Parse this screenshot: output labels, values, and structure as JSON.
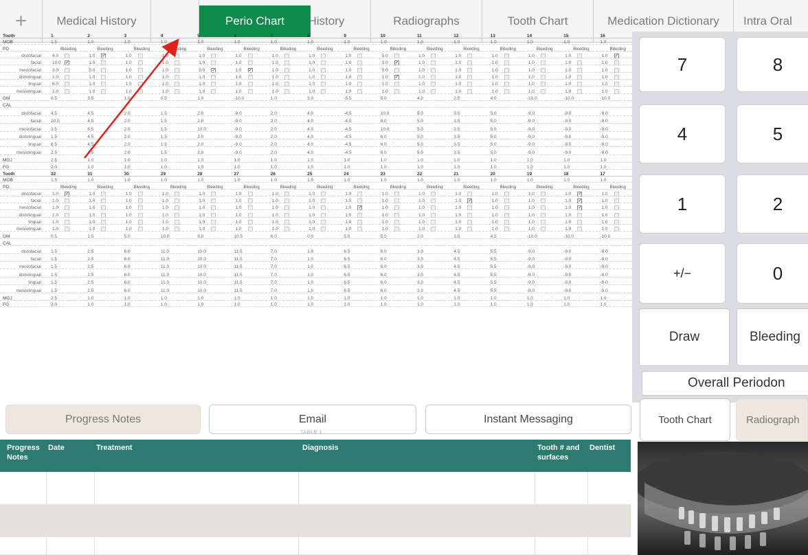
{
  "tabs": {
    "plus": "+",
    "medical_history": "Medical History",
    "perio_chart": "Perio Chart",
    "dental_history": "l History",
    "radiographs": "Radiographs",
    "tooth_chart": "Tooth Chart",
    "medication_dictionary": "Medication Dictionary",
    "intra_oral": "Intra Oral"
  },
  "perio": {
    "upper_teeth": [
      "1",
      "2",
      "3",
      "4",
      "5",
      "6",
      "7",
      "8",
      "9",
      "10",
      "11",
      "12",
      "13",
      "14",
      "15",
      "16"
    ],
    "lower_teeth": [
      "32",
      "31",
      "30",
      "29",
      "28",
      "27",
      "26",
      "25",
      "24",
      "23",
      "22",
      "21",
      "20",
      "19",
      "18",
      "17"
    ],
    "labels": {
      "tooth": "Tooth",
      "mob": "MOB",
      "pd": "PD",
      "gm": "GM",
      "cal": "CAL",
      "mgj": "MGJ",
      "fg": "FG",
      "bleeding": "Bleeding",
      "surfaces": [
        "distofacial",
        "facial",
        "mesiofacial",
        "distolingual",
        "lingual",
        "mesiolingual"
      ]
    },
    "upper_mob": [
      "1.5",
      "1.0",
      "1.0",
      "1.0",
      "1.0",
      "1.0",
      "1.0",
      "1.0",
      "1.0",
      "1.0",
      "1.0",
      "1.0",
      "1.0",
      "1.0",
      "1.0",
      "1.0"
    ],
    "upper_pd": [
      [
        "4.0",
        "1.0",
        "1.0",
        "1.0",
        "1.0",
        "1.0",
        "1.0",
        "1.0",
        "1.0",
        "5.0",
        "1.0",
        "1.0",
        "1.0",
        "1.0",
        "1.0",
        "1.0"
      ],
      [
        "10.0",
        "1.0",
        "1.0",
        "1.0",
        "1.0",
        "1.0",
        "1.0",
        "1.0",
        "1.0",
        "3.0",
        "1.0",
        "1.0",
        "1.0",
        "1.0",
        "1.0",
        "1.0"
      ],
      [
        "3.0",
        "5.0",
        "1.0",
        "1.0",
        "9.0",
        "1.0",
        "1.0",
        "1.0",
        "1.0",
        "5.0",
        "1.0",
        "1.0",
        "1.0",
        "1.0",
        "1.0",
        "1.0"
      ],
      [
        "1.0",
        "1.0",
        "1.0",
        "1.0",
        "1.0",
        "1.0",
        "1.0",
        "1.0",
        "1.0",
        "1.0",
        "1.0",
        "1.0",
        "1.0",
        "1.0",
        "1.0",
        "1.0"
      ],
      [
        "6.0",
        "1.0",
        "1.0",
        "1.0",
        "1.0",
        "1.0",
        "1.0",
        "1.0",
        "1.0",
        "1.0",
        "1.0",
        "1.0",
        "1.0",
        "1.0",
        "1.0",
        "1.0"
      ],
      [
        "2.0",
        "1.0",
        "1.0",
        "1.0",
        "1.0",
        "1.0",
        "1.0",
        "1.0",
        "1.0",
        "1.0",
        "1.0",
        "1.0",
        "1.0",
        "1.0",
        "1.0",
        "1.0"
      ]
    ],
    "upper_bleeding_on": [
      [
        0,
        1
      ],
      [
        0,
        15
      ],
      [
        1,
        0
      ],
      [
        2,
        4
      ],
      [
        2,
        5
      ],
      [
        1,
        9
      ],
      [
        3,
        9
      ]
    ],
    "upper_gm": [
      "0.5",
      "3.5",
      "1.0",
      "0.5",
      "1.0",
      "-10.0",
      "1.0",
      "3.0",
      "-5.5",
      "5.0",
      "4.0",
      "2.5",
      "4.0",
      "-10.0",
      "-10.0",
      "-10.0"
    ],
    "upper_cal": [
      [
        "4.5",
        "4.5",
        "2.0",
        "1.5",
        "2.0",
        "-9.0",
        "2.0",
        "4.0",
        "-4.5",
        "10.0",
        "5.0",
        "3.5",
        "5.0",
        "-9.0",
        "-9.0",
        "-9.0"
      ],
      [
        "10.5",
        "4.5",
        "2.0",
        "1.5",
        "2.0",
        "-9.0",
        "2.0",
        "4.0",
        "-4.5",
        "8.0",
        "5.0",
        "3.5",
        "5.0",
        "-9.0",
        "-9.0",
        "-9.0"
      ],
      [
        "3.5",
        "8.5",
        "2.0",
        "1.5",
        "10.0",
        "-9.0",
        "2.0",
        "4.0",
        "-4.5",
        "10.0",
        "5.0",
        "3.5",
        "5.0",
        "-9.0",
        "-9.0",
        "-9.0"
      ],
      [
        "1.5",
        "4.5",
        "2.0",
        "1.5",
        "2.0",
        "-9.0",
        "2.0",
        "4.0",
        "-4.5",
        "6.0",
        "5.0",
        "3.5",
        "5.0",
        "-9.0",
        "-9.0",
        "-9.0"
      ],
      [
        "6.5",
        "4.5",
        "2.0",
        "1.5",
        "2.0",
        "-9.0",
        "2.0",
        "4.0",
        "-4.5",
        "6.0",
        "5.0",
        "3.5",
        "5.0",
        "-9.0",
        "-9.0",
        "-9.0"
      ],
      [
        "2.5",
        "4.5",
        "2.0",
        "1.5",
        "2.0",
        "-9.0",
        "2.0",
        "4.0",
        "-4.5",
        "6.0",
        "5.0",
        "3.5",
        "5.0",
        "-9.0",
        "-9.0",
        "-9.0"
      ]
    ],
    "upper_mgj": [
      "2.5",
      "1.0",
      "1.0",
      "1.0",
      "1.0",
      "1.0",
      "1.0",
      "1.0",
      "1.0",
      "1.0",
      "1.0",
      "1.0",
      "1.0",
      "1.0",
      "1.0",
      "1.0"
    ],
    "upper_fg": [
      "2.0",
      "1.0",
      "1.0",
      "1.0",
      "1.0",
      "1.0",
      "1.0",
      "1.0",
      "1.0",
      "1.0",
      "1.0",
      "1.0",
      "1.0",
      "1.0",
      "1.0",
      "1.0"
    ],
    "lower_mob": [
      "1.5",
      "1.0",
      "1.0",
      "1.0",
      "1.0",
      "1.0",
      "1.0",
      "1.0",
      "1.0",
      "1.0",
      "1.0",
      "1.0",
      "1.0",
      "1.0",
      "1.0",
      "1.0"
    ],
    "lower_pd": [
      [
        "1.0",
        "1.0",
        "1.0",
        "1.0",
        "1.0",
        "1.0",
        "1.0",
        "1.0",
        "1.0",
        "1.0",
        "1.0",
        "1.0",
        "1.0",
        "1.0",
        "1.0",
        "1.0"
      ],
      [
        "1.0",
        "1.0",
        "1.0",
        "1.0",
        "1.0",
        "1.0",
        "1.0",
        "1.0",
        "1.0",
        "1.0",
        "1.0",
        "1.0",
        "1.0",
        "1.0",
        "1.0",
        "1.0"
      ],
      [
        "1.0",
        "1.0",
        "1.0",
        "1.0",
        "1.0",
        "1.0",
        "1.0",
        "1.0",
        "1.0",
        "1.0",
        "1.0",
        "1.0",
        "1.0",
        "1.0",
        "1.0",
        "1.0"
      ],
      [
        "1.0",
        "1.0",
        "1.0",
        "1.0",
        "1.0",
        "1.0",
        "1.0",
        "1.0",
        "1.0",
        "1.0",
        "1.0",
        "1.0",
        "1.0",
        "1.0",
        "1.0",
        "1.0"
      ],
      [
        "1.0",
        "1.0",
        "1.0",
        "1.0",
        "1.0",
        "1.0",
        "1.0",
        "1.0",
        "1.0",
        "1.0",
        "1.0",
        "1.0",
        "1.0",
        "1.0",
        "1.0",
        "1.0"
      ],
      [
        "1.0",
        "1.0",
        "1.0",
        "1.0",
        "1.0",
        "1.0",
        "1.0",
        "1.0",
        "1.0",
        "1.0",
        "1.0",
        "1.0",
        "1.0",
        "1.0",
        "1.0",
        "1.0"
      ]
    ],
    "lower_bleeding_on": [
      [
        0,
        0
      ],
      [
        0,
        14
      ],
      [
        1,
        11
      ],
      [
        1,
        14
      ],
      [
        2,
        8
      ],
      [
        2,
        14
      ]
    ],
    "lower_gm": [
      "0.5",
      "1.5",
      "5.0",
      "10.0",
      "9.0",
      "10.5",
      "6.0",
      "0.0",
      "5.5",
      "5.0",
      "2.0",
      "3.5",
      "4.5",
      "-10.0",
      "-10.0",
      "-10.0"
    ],
    "lower_cal": [
      "1.5",
      "2.5",
      "6.0",
      "11.0",
      "10.0",
      "11.5",
      "7.0",
      "1.0",
      "6.5",
      "6.0",
      "3.0",
      "4.5",
      "5.5",
      "-9.0",
      "-9.0",
      "-9.0"
    ],
    "lower_mgj": [
      "2.5",
      "1.0",
      "1.0",
      "1.0",
      "1.0",
      "1.0",
      "1.0",
      "1.0",
      "1.0",
      "1.0",
      "1.0",
      "1.0",
      "1.0",
      "1.0",
      "1.0",
      "1.0"
    ],
    "lower_fg": [
      "2.0",
      "1.0",
      "1.0",
      "1.0",
      "1.0",
      "1.0",
      "1.0",
      "1.0",
      "1.0",
      "1.0",
      "1.0",
      "1.0",
      "1.0",
      "1.0",
      "1.0",
      "1.0"
    ]
  },
  "keypad": {
    "keys": [
      "7",
      "8",
      "4",
      "5",
      "1",
      "2",
      "+/−",
      "0"
    ],
    "draw": "Draw",
    "bleeding": "Bleeding",
    "overall": "Overall Periodon",
    "tooth_chart": "Tooth Chart",
    "radiographs": "Radiograph"
  },
  "bottom": {
    "progress_notes": "Progress Notes",
    "email": "Email",
    "instant_messaging": "Instant Messaging",
    "table_caption": "TABLE 1"
  },
  "progress_table": {
    "headers": [
      "Progress Notes",
      "Date",
      "Treatment",
      "Diagnosis",
      "Tooth # and surfaces",
      "Dentist"
    ]
  },
  "colors": {
    "accent_green": "#0e8a4a",
    "table_header": "#2c7b70",
    "arrow": "#e0201b"
  }
}
